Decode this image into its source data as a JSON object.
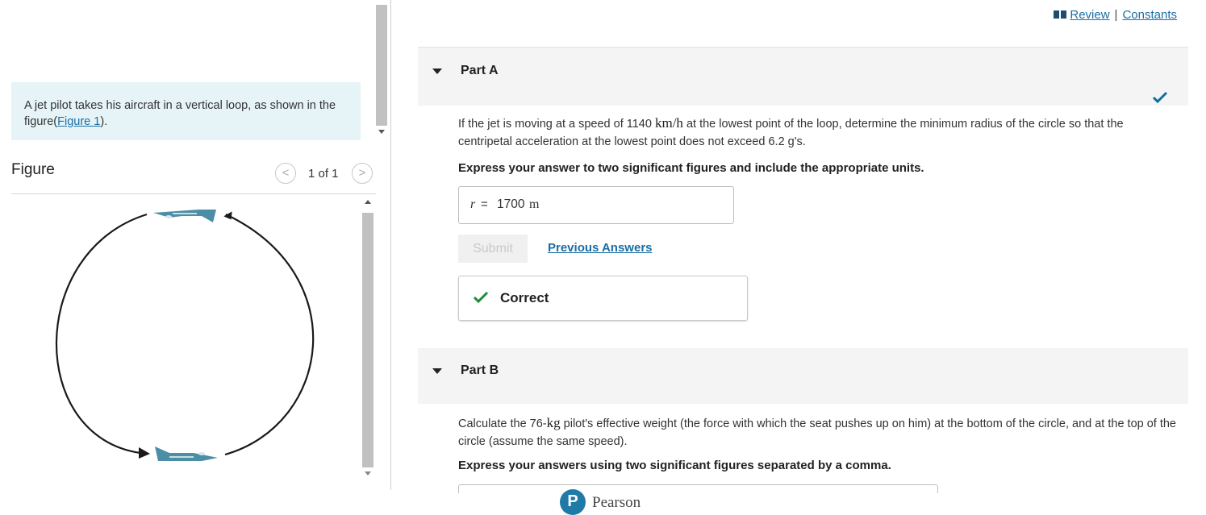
{
  "header": {
    "review_link": "Review",
    "separator": "|",
    "constants_link": "Constants",
    "book_icon": "book-icon"
  },
  "left": {
    "intro_text": "A jet pilot takes his aircraft in a vertical loop, as shown in the figure(",
    "intro_link": "Figure 1",
    "intro_end": ").",
    "figure_title": "Figure",
    "figure_count": "1 of 1",
    "prev_icon": "<",
    "next_icon": ">"
  },
  "partA": {
    "label": "Part A",
    "question_1": "If the jet is moving at a speed of 1140 ",
    "question_unit": "km/h",
    "question_2": " at the lowest point of the loop, determine the minimum radius of the circle so that the centripetal acceleration at the lowest point does not exceed 6.2 g's.",
    "instruction": "Express your answer to two significant figures and include the appropriate units.",
    "answer_var": "r",
    "answer_eq": "=",
    "answer_value": "1700",
    "answer_unit": "m",
    "submit_label": "Submit",
    "previous_answers": "Previous Answers",
    "result_label": "Correct",
    "status_color": "#0f6e9e",
    "correct_color": "#1e8a3b"
  },
  "partB": {
    "label": "Part B",
    "question_1": "Calculate the 76-",
    "question_unit": "kg",
    "question_2": " pilot's effective weight (the force with which the seat pushes up on him) at the bottom of the circle, and at the top of the circle (assume the same speed).",
    "instruction": "Express your answers using two significant figures separated by a comma."
  },
  "footer": {
    "brand": "Pearson",
    "brand_letter": "P"
  }
}
